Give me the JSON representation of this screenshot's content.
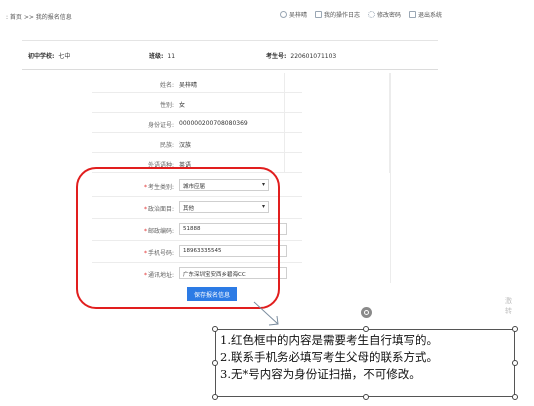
{
  "breadcrumb": ": 首页 >> 我的报名信息",
  "top_links": [
    {
      "label": "吴梓晴",
      "icon": "user-icon"
    },
    {
      "label": "我的操作日志",
      "icon": "log-icon"
    },
    {
      "label": "修改密码",
      "icon": "gear-icon"
    },
    {
      "label": "退出系统",
      "icon": "exit-icon"
    }
  ],
  "header": {
    "school_label": "初中学校:",
    "school_value": "七中",
    "class_label": "班级:",
    "class_value": "11",
    "exam_no_label": "考生号:",
    "exam_no_value": "220601071103"
  },
  "rows": [
    {
      "label": "姓名:",
      "value": "吴梓晴",
      "required": false
    },
    {
      "label": "性别:",
      "value": "女",
      "required": false
    },
    {
      "label": "身份证号:",
      "value": "000000200708080369",
      "required": false
    },
    {
      "label": "民族:",
      "value": "汉族",
      "required": false
    },
    {
      "label": "外语语种:",
      "value": "英语",
      "required": false
    }
  ],
  "form": [
    {
      "label": "考生类别:",
      "value": "城市应届",
      "type": "select"
    },
    {
      "label": "政治面目:",
      "value": "其他",
      "type": "select"
    },
    {
      "label": "邮政编码:",
      "value": "51888",
      "type": "input"
    },
    {
      "label": "手机号码:",
      "value": "18963335545",
      "type": "input"
    },
    {
      "label": "通讯地址:",
      "value": "广东深圳宝安西乡碧海CC",
      "type": "input"
    }
  ],
  "required_mark": "*",
  "save_button": "保存报名信息",
  "watermark": [
    "激",
    "转"
  ],
  "annotation": [
    "1.红色框中的内容是需要考生自行填写的。",
    "2.联系手机务必填写考生父母的联系方式。",
    "3.无*号内容为身份证扫描，不可修改。"
  ],
  "colors": {
    "frame": "#e11e1e",
    "button": "#2c7be5",
    "required": "#e03030"
  }
}
